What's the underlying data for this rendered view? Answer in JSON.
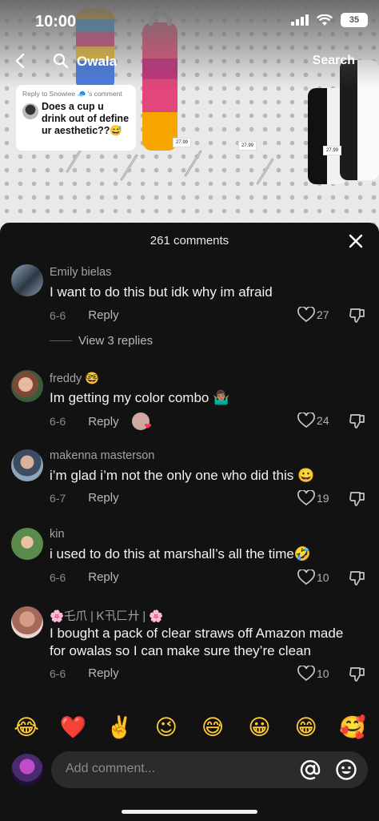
{
  "status_bar": {
    "time": "10:00",
    "battery": "35"
  },
  "search": {
    "query": "Owala",
    "button": "Search"
  },
  "video": {
    "price_tags": [
      "27.99",
      "27.99",
      "27.99"
    ],
    "reply_sticker": {
      "header": "Reply to Snowiee 🧢 's comment",
      "text": "Does a cup u drink out of define ur aesthetic??😅"
    }
  },
  "sheet": {
    "title": "261 comments"
  },
  "comments": [
    {
      "user": "Emily bielas",
      "text": "I want to do this but idk why im afraid",
      "date": "6-6",
      "reply": "Reply",
      "likes": "27",
      "view_replies": "View 3 replies"
    },
    {
      "user": "freddy 🤓",
      "text": "Im getting my color combo 🤷🏽‍♂️",
      "date": "6-6",
      "reply": "Reply",
      "likes": "24"
    },
    {
      "user": "makenna masterson",
      "text": "i’m glad i’m not the only one who did this 😀",
      "date": "6-7",
      "reply": "Reply",
      "likes": "19"
    },
    {
      "user": "kin",
      "text": "i used to do this at marshall’s all the time🤣",
      "date": "6-6",
      "reply": "Reply",
      "likes": "10"
    },
    {
      "user": "🌸乇爪 | Ꮶ卂匚廾 | 🌸",
      "text": "I bought a pack of clear straws off Amazon made for owalas so I can make sure they’re clean",
      "date": "6-6",
      "reply": "Reply",
      "likes": "10"
    }
  ],
  "emoji_bar": [
    "😂",
    "❤️",
    "✌️",
    "😉",
    "😅",
    "😀",
    "😁",
    "🥰"
  ],
  "composer": {
    "placeholder": "Add comment..."
  },
  "colors": {
    "sheet_bg": "#121212",
    "input_bg": "#2b2b2b",
    "heart_red": "#ff2f55"
  }
}
